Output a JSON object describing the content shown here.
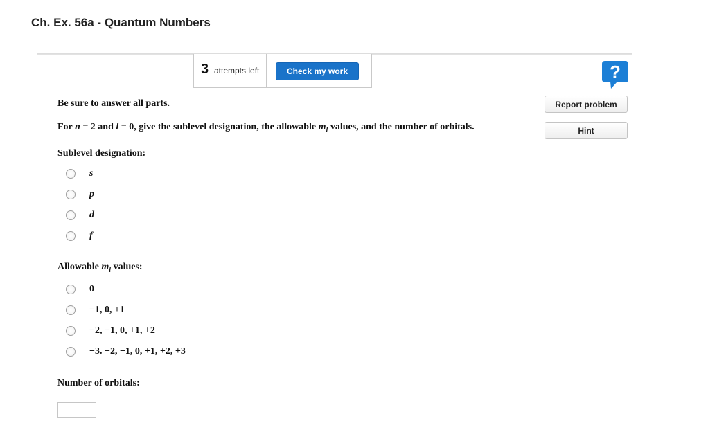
{
  "header": {
    "title": "Ch. Ex. 56a - Quantum Numbers"
  },
  "toolbar": {
    "attempts_count": "3",
    "attempts_label": "attempts left",
    "check_label": "Check my work"
  },
  "sidebar": {
    "help_glyph": "?",
    "report_label": "Report problem",
    "hint_label": "Hint"
  },
  "question": {
    "instruction": "Be sure to answer all parts.",
    "prompt_parts": {
      "for": "For ",
      "n_var": "n",
      "n_val": " = 2 and ",
      "l_var": "l",
      "l_val": " = 0, give the sublevel designation, the allowable ",
      "m_var": "m",
      "m_sub": "l",
      "tail": " values, and the number of orbitals."
    }
  },
  "sublevel": {
    "label": "Sublevel designation:",
    "options": [
      "s",
      "p",
      "d",
      "f"
    ]
  },
  "ml_values": {
    "label_pre": "Allowable ",
    "label_var": "m",
    "label_sub": "l",
    "label_post": " values:",
    "options": [
      "0",
      "−1, 0, +1",
      "−2, −1, 0, +1, +2",
      "−3. −2, −1, 0, +1, +2, +3"
    ]
  },
  "orbitals": {
    "label": "Number of orbitals:",
    "value": ""
  },
  "colors": {
    "accent": "#1a73c9",
    "help_icon": "#1c7fd6"
  }
}
